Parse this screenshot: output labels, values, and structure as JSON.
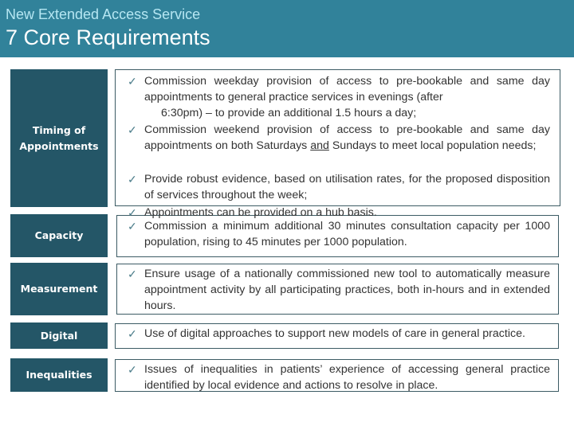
{
  "header": {
    "supertitle": "New Extended Access Service",
    "title": "7 Core Requirements",
    "color": "#31829a"
  },
  "sections": [
    {
      "label_line1": "Timing of",
      "label_line2": "Appointments",
      "items": [
        {
          "text_a": "Commission weekday provision of access to pre-bookable and same day appointments to general practice services in evenings (after",
          "text_b": "6:30pm) – to provide an additional 1.5 hours a day;"
        },
        {
          "text_a": "Commission weekend provision of access to pre-bookable and same day appointments on both Saturdays ",
          "underlined": "and",
          "text_b": " Sundays to meet local population needs;"
        },
        {
          "text": "Provide robust evidence, based on utilisation rates, for the proposed disposition of services throughout the week;"
        },
        {
          "text": "Appointments can be provided on a hub basis."
        }
      ]
    },
    {
      "label": "Capacity",
      "items": [
        {
          "text": "Commission a minimum additional 30 minutes consultation capacity per 1000 population, rising to 45 minutes per 1000 population."
        }
      ]
    },
    {
      "label": "Measurement",
      "items": [
        {
          "text": "Ensure usage of a nationally commissioned new tool to automatically measure appointment activity by all participating practices, both in-hours and in extended hours."
        }
      ]
    },
    {
      "label": "Digital",
      "items": [
        {
          "text": "Use of digital approaches to support new models of care in general practice."
        }
      ]
    },
    {
      "label": "Inequalities",
      "items": [
        {
          "text": "Issues of inequalities in patients’ experience of accessing general practice identified by local evidence and actions to resolve in place."
        }
      ]
    }
  ],
  "icons": {
    "bullet": "✓"
  }
}
